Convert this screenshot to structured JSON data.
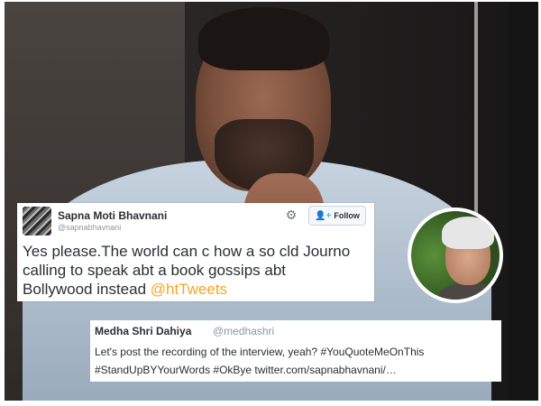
{
  "tweet": {
    "author_name": "Sapna Moti Bhavnani",
    "author_handle": "@sapnabhavnani",
    "follow_label": "Follow",
    "follow_icon": "person-plus-icon",
    "settings_icon": "gear-icon",
    "text_line1": "Yes please.The world can c how a so cld Journo",
    "text_line2": "calling to speak abt a book gossips abt",
    "text_line3": "Bollywood instead",
    "mention": "@htTweets",
    "mention_color": "#f5a623"
  },
  "reply": {
    "author_name": "Medha Shri Dahiya",
    "author_handle": "@medhashri",
    "line1": "Let's post the recording of the interview, yeah? #YouQuoteMeOnThis",
    "line2": "#StandUpBYYourWords #OkBye twitter.com/sapnabhavnani/…"
  }
}
